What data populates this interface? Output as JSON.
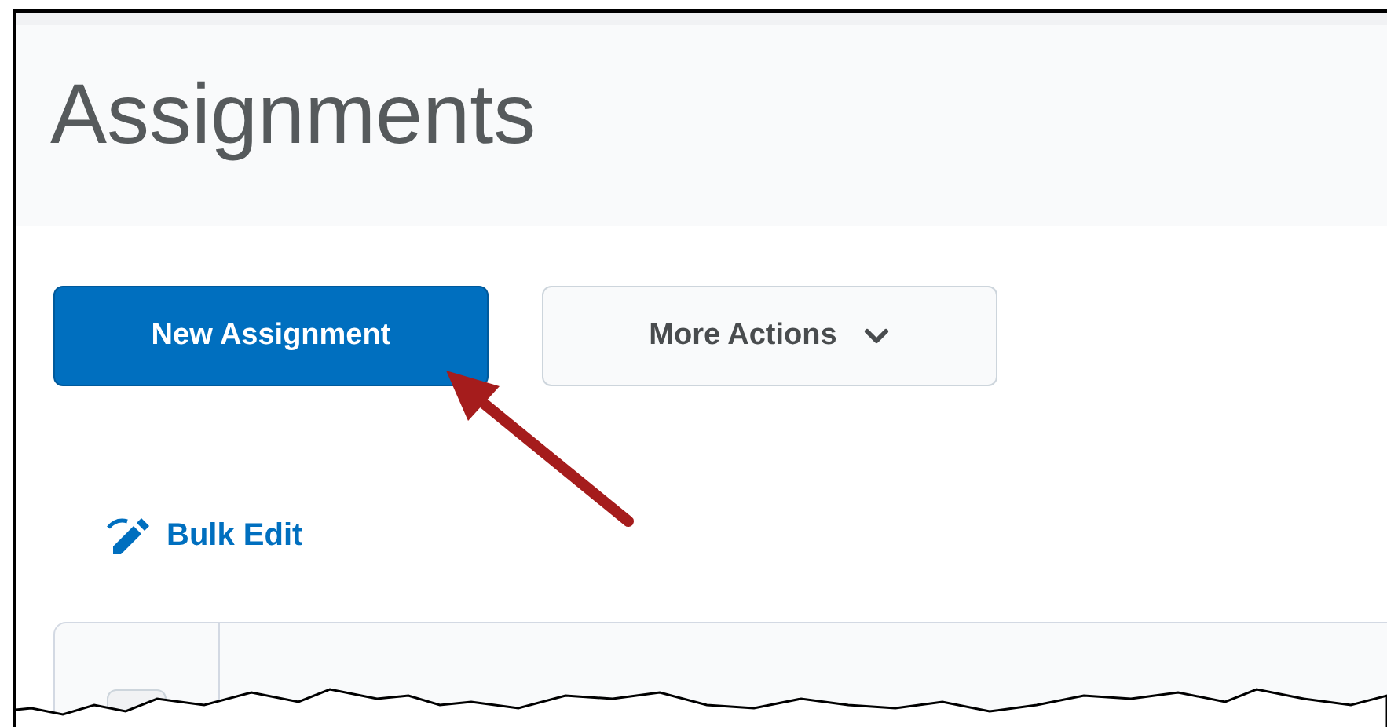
{
  "page": {
    "title": "Assignments"
  },
  "actions": [
    {
      "label": "New Assignment",
      "kind": "primary"
    },
    {
      "label": "More Actions",
      "kind": "dropdown"
    }
  ],
  "bulk_edit": {
    "label": "Bulk Edit"
  }
}
